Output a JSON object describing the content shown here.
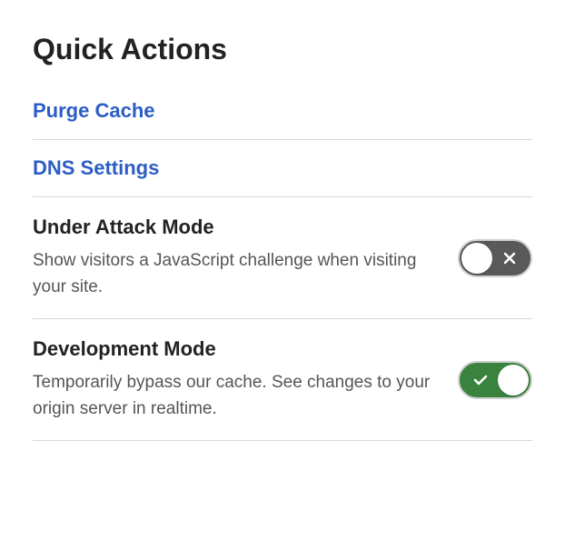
{
  "title": "Quick Actions",
  "links": {
    "purge_cache": "Purge Cache",
    "dns_settings": "DNS Settings"
  },
  "settings": {
    "under_attack": {
      "title": "Under Attack Mode",
      "desc": "Show visitors a JavaScript challenge when visiting your site.",
      "enabled": false
    },
    "development": {
      "title": "Development Mode",
      "desc": "Temporarily bypass our cache. See changes to your origin server in realtime.",
      "enabled": true
    }
  }
}
